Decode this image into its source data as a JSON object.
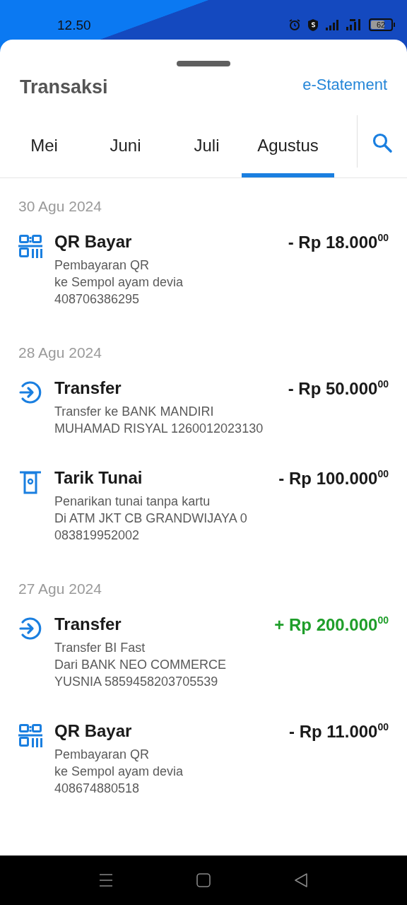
{
  "status_bar": {
    "time": "12.50",
    "battery": "62"
  },
  "header": {
    "title": "Transaksi",
    "link": "e-Statement"
  },
  "tabs": [
    {
      "label": "Mei",
      "selected": false
    },
    {
      "label": "Juni",
      "selected": false
    },
    {
      "label": "Juli",
      "selected": false
    },
    {
      "label": "Agustus",
      "selected": true
    }
  ],
  "groups": [
    {
      "date": "30 Agu 2024",
      "items": [
        {
          "kind": "qr",
          "title": "QR Bayar",
          "amount": "- Rp 18.000$^{00}$",
          "credit": false,
          "lines": [
            "Pembayaran QR",
            "ke Sempol ayam devia",
            "408706386295"
          ]
        }
      ]
    },
    {
      "date": "28 Agu 2024",
      "items": [
        {
          "kind": "transfer",
          "title": "Transfer",
          "amount": "- Rp 50.000$^{00}$",
          "credit": false,
          "lines": [
            "Transfer ke BANK MANDIRI",
            "MUHAMAD RISYAL 1260012023130"
          ]
        },
        {
          "kind": "atm",
          "title": "Tarik Tunai",
          "amount": "- Rp 100.000$^{00}$",
          "credit": false,
          "lines": [
            "Penarikan tunai tanpa kartu",
            "Di ATM JKT CB GRANDWIJAYA 0",
            "083819952002"
          ]
        }
      ]
    },
    {
      "date": "27 Agu 2024",
      "items": [
        {
          "kind": "transfer",
          "title": "Transfer",
          "amount": "+ Rp 200.000$^{00}$",
          "credit": true,
          "lines": [
            "Transfer BI Fast",
            "Dari BANK NEO COMMERCE",
            "YUSNIA 5859458203705539"
          ]
        },
        {
          "kind": "qr",
          "title": "QR Bayar",
          "amount": "- Rp 11.000$^{00}$",
          "credit": false,
          "lines": [
            "Pembayaran QR",
            "ke Sempol ayam devia",
            "408674880518"
          ]
        }
      ]
    }
  ]
}
